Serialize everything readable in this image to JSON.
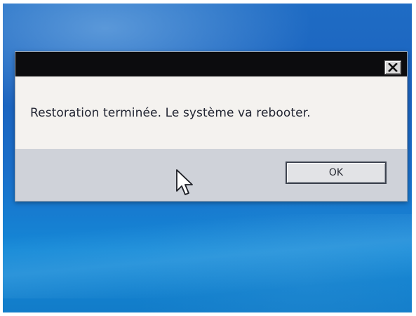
{
  "dialog": {
    "message": "Restoration terminée. Le système va rebooter.",
    "ok_label": "OK"
  },
  "icons": {
    "close": "close-icon",
    "cursor": "mouse-pointer-icon"
  },
  "colors": {
    "desktop_blue": "#1a6fca",
    "titlebar": "#0c0c0e",
    "message_background": "#f4f2ef",
    "button_area": "#cfd2d9"
  }
}
